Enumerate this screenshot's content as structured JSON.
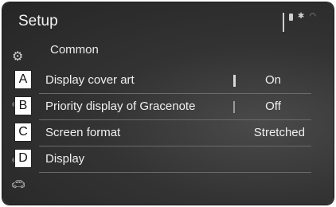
{
  "header": {
    "title": "Setup"
  },
  "section": {
    "title": "Common"
  },
  "callouts": [
    "A",
    "B",
    "C",
    "D"
  ],
  "rows": [
    {
      "label": "Display cover art",
      "value": "On"
    },
    {
      "label": "Priority display of Gracenote",
      "value": "Off"
    },
    {
      "label": "Screen format",
      "value": "Stretched"
    },
    {
      "label": "Display",
      "value": ""
    }
  ],
  "icons": {
    "signal": "signal-icon",
    "battery": "battery-icon",
    "bluetooth": "bluetooth-icon",
    "wifi": "wifi-icon",
    "settings": "gear-icon",
    "vehicle": "car-icon"
  },
  "colors": {
    "background": "#333333",
    "text": "#f0f0f0",
    "divider": "#6b6b6b"
  }
}
